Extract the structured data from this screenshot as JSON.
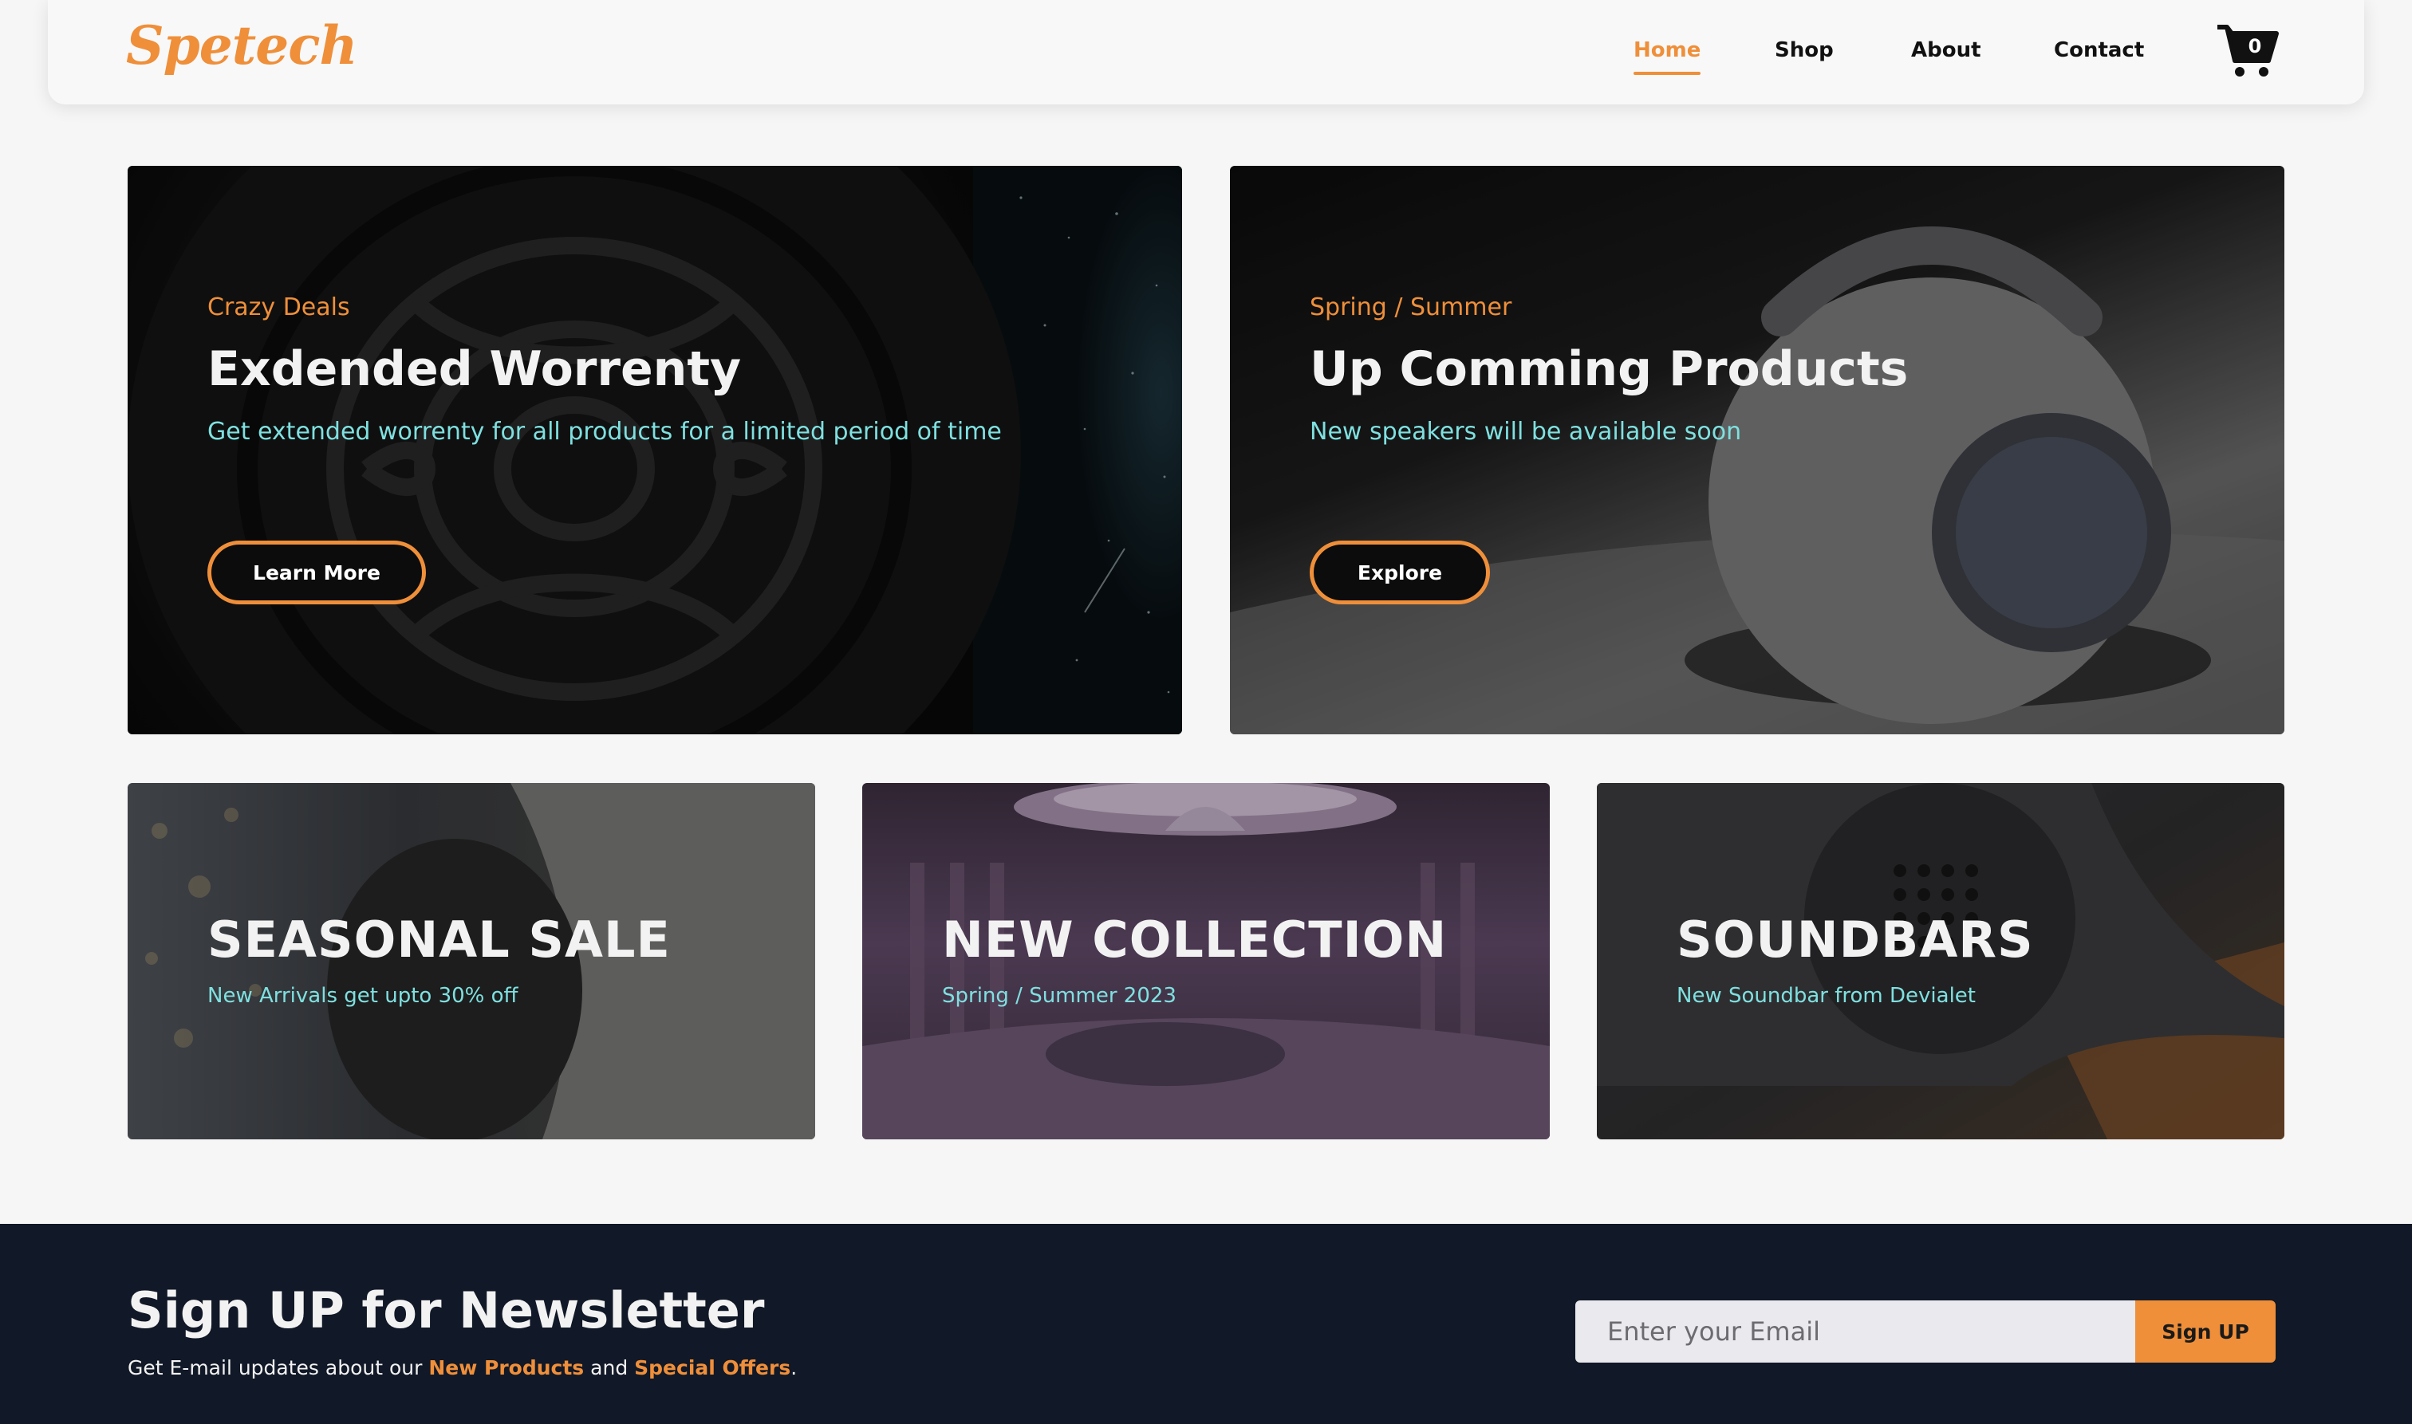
{
  "header": {
    "logo": "Spetech",
    "nav": [
      "Home",
      "Shop",
      "About",
      "Contact"
    ],
    "active_nav": "Home",
    "cart_count": "0"
  },
  "hero": [
    {
      "eyebrow": "Crazy Deals",
      "title": "Exdended Worrenty",
      "subtitle": "Get extended worrenty for all products for a limited period of time",
      "button": "Learn More"
    },
    {
      "eyebrow": "Spring / Summer",
      "title": "Up Comming Products",
      "subtitle": "New speakers will be available soon",
      "button": "Explore"
    }
  ],
  "tiles": [
    {
      "title": "SEASONAL SALE",
      "subtitle": "New Arrivals get upto 30% off"
    },
    {
      "title": "NEW COLLECTION",
      "subtitle": "Spring / Summer 2023"
    },
    {
      "title": "SOUNDBARS",
      "subtitle": "New Soundbar from Devialet"
    }
  ],
  "newsletter": {
    "title": "Sign UP for Newsletter",
    "text_prefix": "Get E-mail updates about our ",
    "highlight1": "New Products",
    "text_middle": " and ",
    "highlight2": "Special Offers",
    "text_suffix": ".",
    "email_placeholder": "Enter your Email",
    "button": "Sign UP"
  },
  "colors": {
    "accent": "#ef8f3a",
    "subtitle_cyan": "#7fe0e0",
    "footer_bg": "#111827"
  }
}
